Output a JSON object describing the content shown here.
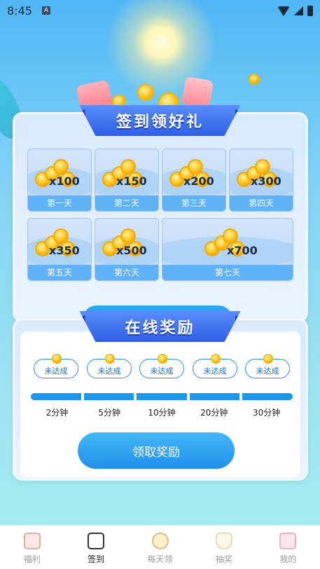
{
  "status_bar": {
    "time": "8:45",
    "badge": "A"
  },
  "checkin": {
    "title": "签到领好礼",
    "days": [
      {
        "amount": "x100",
        "label": "第一天"
      },
      {
        "amount": "x150",
        "label": "第二天"
      },
      {
        "amount": "x200",
        "label": "第三天"
      },
      {
        "amount": "x300",
        "label": "第四天"
      },
      {
        "amount": "x350",
        "label": "第五天"
      },
      {
        "amount": "x500",
        "label": "第六天"
      },
      {
        "amount": "x700",
        "label": "第七天"
      }
    ]
  },
  "online": {
    "title": "在线奖励",
    "rewards": [
      {
        "status": "未达成",
        "time": "2分钟"
      },
      {
        "status": "未达成",
        "time": "5分钟"
      },
      {
        "status": "未达成",
        "time": "10分钟"
      },
      {
        "status": "未达成",
        "time": "20分钟"
      },
      {
        "status": "未达成",
        "time": "30分钟"
      }
    ],
    "claim_label": "领取奖励"
  },
  "nav": {
    "items": [
      {
        "label": "福利",
        "icon": "star-icon"
      },
      {
        "label": "签到",
        "icon": "calendar-icon"
      },
      {
        "label": "每天领",
        "icon": "coin-icon"
      },
      {
        "label": "抽奖",
        "icon": "trophy-icon"
      },
      {
        "label": "我的",
        "icon": "gift-icon"
      }
    ],
    "active_index": 1
  },
  "colors": {
    "primary": "#1f8fea",
    "ribbon": "#2d5fe6",
    "gold": "#ffc21a"
  }
}
